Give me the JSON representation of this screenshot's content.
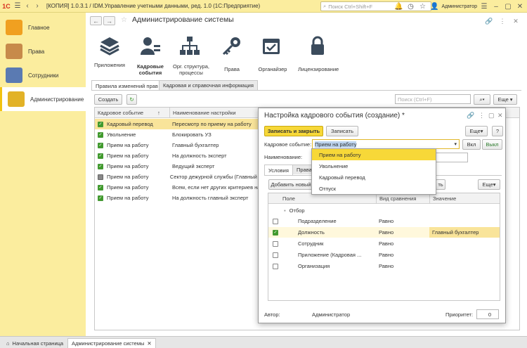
{
  "titlebar": {
    "logo": "1С",
    "title": "[КОПИЯ] 1.0.3.1 / IDM.Управление учетными данными, ред. 1.0  (1С:Предприятие)",
    "search_placeholder": "Поиск Ctrl+Shift+F",
    "user": "Администратор"
  },
  "sidebar": {
    "items": [
      {
        "label": "Главное",
        "icon": "home-icon"
      },
      {
        "label": "Права",
        "icon": "rights-icon"
      },
      {
        "label": "Сотрудники",
        "icon": "employees-icon"
      },
      {
        "label": "Администрирование",
        "icon": "admin-icon"
      }
    ]
  },
  "header": {
    "title": "Администрирование системы"
  },
  "sections": [
    {
      "label": "Приложения"
    },
    {
      "label": "Кадровые события"
    },
    {
      "label": "Орг. структура, процессы"
    },
    {
      "label": "Права"
    },
    {
      "label": "Органайзер"
    },
    {
      "label": "Лицензирование"
    }
  ],
  "tabs": [
    "Правила изменений прав",
    "Кадровая и справочная информация"
  ],
  "toolbar": {
    "create": "Создать",
    "search_placeholder": "Поиск (Ctrl+F)",
    "more": "Еще"
  },
  "table": {
    "col1": "Кадровое событие",
    "col2": "Наименование настройки",
    "rows": [
      {
        "event": "Кадровый перевод",
        "name": "Пересмотр по приему на работу"
      },
      {
        "event": "Увольнение",
        "name": "Блокировать УЗ"
      },
      {
        "event": "Прием на работу",
        "name": "Главный бухгалтер"
      },
      {
        "event": "Прием на работу",
        "name": "На должность эксперт"
      },
      {
        "event": "Прием на работу",
        "name": "Ведущий эксперт"
      },
      {
        "event": "Прием на работу",
        "name": "Сектор дежурной службы (Главный эк"
      },
      {
        "event": "Прием на работу",
        "name": "Всем, если нет других критериев на"
      },
      {
        "event": "Прием на работу",
        "name": "На должность главный эксперт"
      }
    ]
  },
  "dialog": {
    "title": "Настройка кадрового события (создание) *",
    "save_close": "Записать и закрыть",
    "save": "Записать",
    "more": "Еще",
    "help": "?",
    "event_label": "Кадровое событие:",
    "event_value": "Прием на работу",
    "on": "Вкл",
    "off": "Выкл",
    "name_label": "Наименование:",
    "tab1": "Условия",
    "tab2": "Права",
    "add_new": "Добавить новый",
    "ret": "ть",
    "more2": "Еще",
    "grid_cols": {
      "field": "Поле",
      "compare": "Вид сравнения",
      "value": "Значение"
    },
    "group": "Отбор",
    "rows": [
      {
        "field": "Подразделение",
        "compare": "Равно",
        "value": ""
      },
      {
        "field": "Должность",
        "compare": "Равно",
        "value": "Главный бухгалтер"
      },
      {
        "field": "Сотрудник",
        "compare": "Равно",
        "value": ""
      },
      {
        "field": "Приложение (Кадровая ...",
        "compare": "Равно",
        "value": ""
      },
      {
        "field": "Организация",
        "compare": "Равно",
        "value": ""
      }
    ],
    "author_label": "Автор:",
    "author": "Администратор",
    "priority_label": "Приоритет:",
    "priority": "0"
  },
  "dropdown": [
    "Прием на работу",
    "Увольнение",
    "Кадровый перевод",
    "Отпуск"
  ],
  "bottom": {
    "home": "Начальная страница",
    "tab": "Администрирование системы"
  }
}
